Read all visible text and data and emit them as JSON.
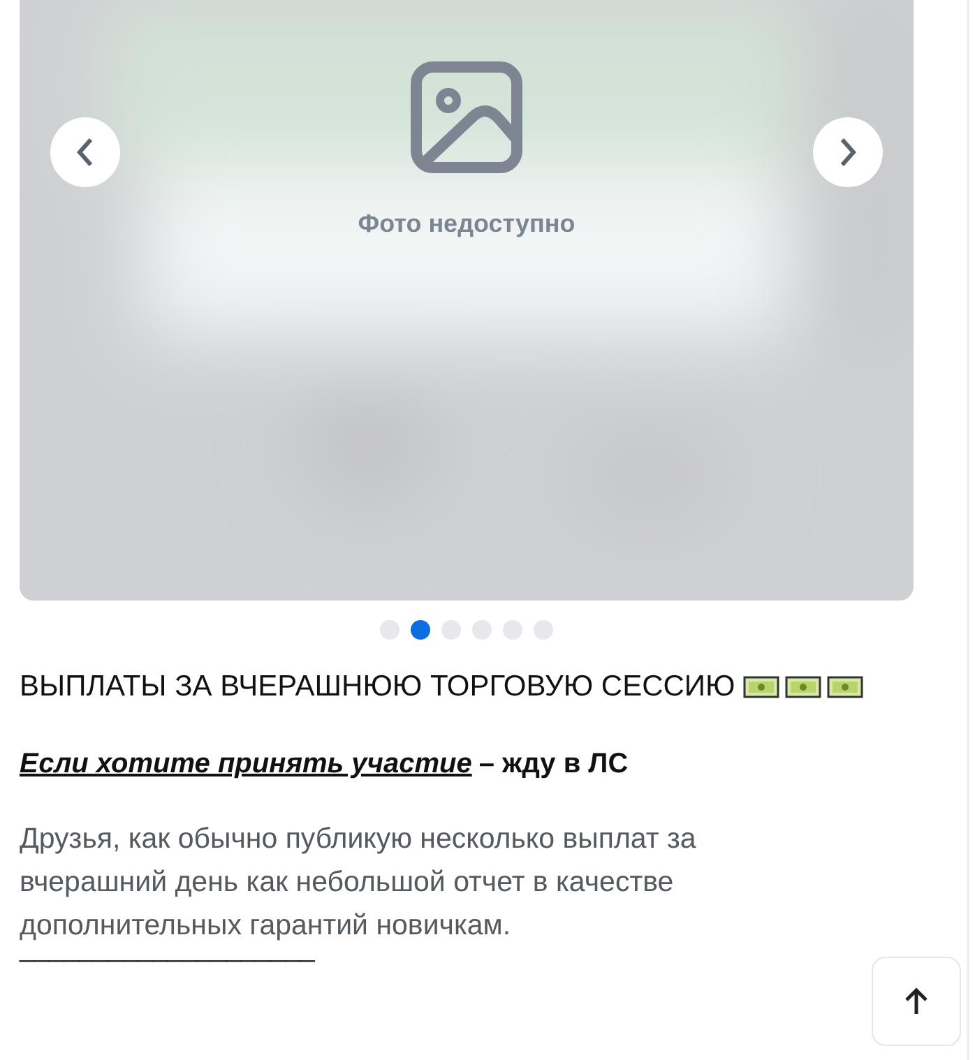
{
  "gallery": {
    "caption": "Фото недоступно",
    "dots": [
      {
        "selected": false
      },
      {
        "selected": true
      },
      {
        "selected": false
      },
      {
        "selected": false
      },
      {
        "selected": false
      },
      {
        "selected": false
      }
    ]
  },
  "post": {
    "title": "ВЫПЛАТЫ ЗА ВЧЕРАШНЮЮ ТОРГОВУЮ СЕССИЮ",
    "title_icons": [
      {
        "kind": "banknote"
      },
      {
        "kind": "banknote"
      },
      {
        "kind": "banknote"
      }
    ],
    "invite": {
      "link": "Если хотите принять участие",
      "rest": "– жду в ЛС"
    },
    "body": "Друзья, как обычно публикую несколько выплат за вчерашний день как небольшой отчет в качестве дополнительных гарантий новичкам.",
    "divider": "____________________"
  }
}
